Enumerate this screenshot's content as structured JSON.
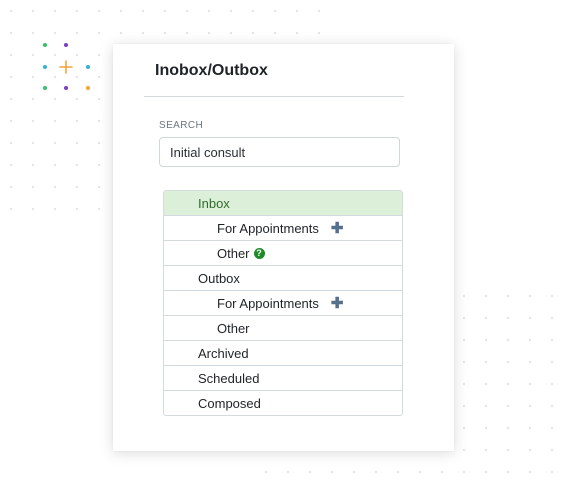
{
  "panel": {
    "title": "Inobox/Outbox"
  },
  "search": {
    "label": "SEARCH",
    "value": "Initial consult"
  },
  "tree": {
    "items": [
      {
        "label": "Inbox",
        "level": 1,
        "active": true
      },
      {
        "label": "For Appointments",
        "level": 2,
        "icon": "plus-icon"
      },
      {
        "label": "Other",
        "level": 2,
        "icon": "help-icon"
      },
      {
        "label": "Outbox",
        "level": 1
      },
      {
        "label": "For Appointments",
        "level": 2,
        "icon": "plus-icon"
      },
      {
        "label": "Other",
        "level": 2
      },
      {
        "label": "Archived",
        "level": 1
      },
      {
        "label": "Scheduled",
        "level": 1
      },
      {
        "label": "Composed",
        "level": 1
      }
    ]
  },
  "colors": {
    "active_row_bg": "#dcefd8",
    "active_row_text": "#2f6c2c",
    "plus_icon": "#55708d",
    "help_icon": "#1e8a28"
  }
}
